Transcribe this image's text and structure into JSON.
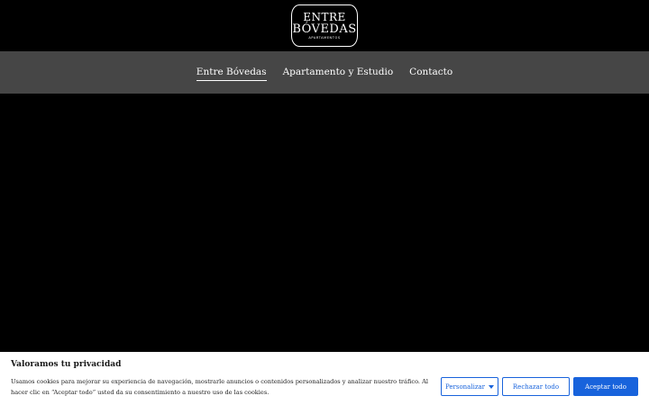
{
  "header": {
    "logo": {
      "line1": "ENTRE",
      "line2": "BÓVEDAS",
      "line3": "APARTAMENTOS"
    }
  },
  "nav": {
    "items": [
      {
        "label": "Entre Bóvedas",
        "active": true
      },
      {
        "label": "Apartamento y Estudio",
        "active": false
      },
      {
        "label": "Contacto",
        "active": false
      }
    ]
  },
  "cookie_banner": {
    "title": "Valoramos tu privacidad",
    "text": "Usamos cookies para mejorar su experiencia de navegación, mostrarle anuncios o contenidos personalizados y analizar nuestro tráfico. Al hacer clic en “Aceptar todo” usted da su consentimiento a nuestro uso de las cookies.",
    "customize_label": "Personalizar",
    "reject_label": "Rechazar todo",
    "accept_label": "Aceptar todo",
    "accent_color": "#1863dc"
  },
  "colors": {
    "background": "#000000",
    "navbar": "#464646",
    "banner": "#ffffff"
  }
}
